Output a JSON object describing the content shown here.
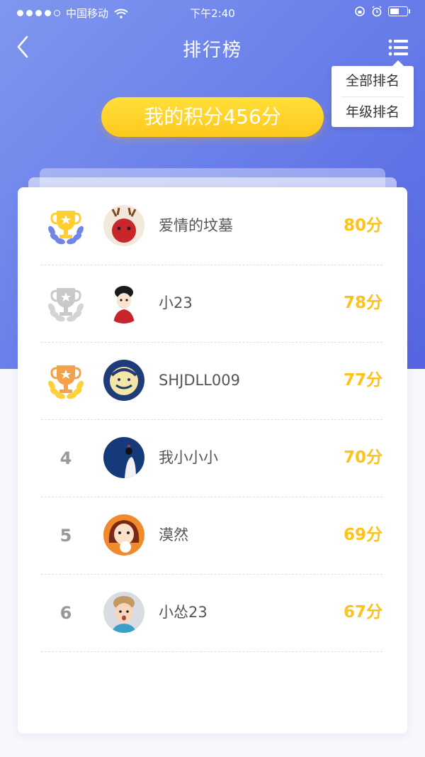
{
  "status_bar": {
    "carrier": "中国移动",
    "time": "下午2:40",
    "signal_dots_filled": 4,
    "signal_dots_total": 5,
    "battery_level": 0.55
  },
  "nav": {
    "title": "排行榜",
    "back_icon": "back-chevron-icon",
    "menu_icon": "list-menu-icon"
  },
  "dropdown": {
    "items": [
      {
        "label": "全部排名"
      },
      {
        "label": "年级排名"
      }
    ]
  },
  "my_score": {
    "label": "我的积分456分"
  },
  "colors": {
    "hero_start": "#7f97ee",
    "hero_end": "#5565e2",
    "accent_yellow": "#ffc21b",
    "trophy_gold": "#ffcf2f",
    "trophy_silver": "#d0d0d0",
    "trophy_bronze": "#f5a14a",
    "laurel_first": "#6f86e8"
  },
  "rankings": [
    {
      "rank": "1",
      "trophy": "trophy-first",
      "name": "爱情的坟墓",
      "score": "80分",
      "avatar": "avatar-icon"
    },
    {
      "rank": "2",
      "trophy": "trophy-second",
      "name": "小23",
      "score": "78分",
      "avatar": "avatar-icon"
    },
    {
      "rank": "3",
      "trophy": "trophy-third",
      "name": "SHJDLL009",
      "score": "77分",
      "avatar": "avatar-icon"
    },
    {
      "rank": "4",
      "name": "我小小小",
      "score": "70分",
      "avatar": "avatar-icon"
    },
    {
      "rank": "5",
      "name": "漠然",
      "score": "69分",
      "avatar": "avatar-icon"
    },
    {
      "rank": "6",
      "name": "小怂23",
      "score": "67分",
      "avatar": "avatar-icon"
    }
  ]
}
